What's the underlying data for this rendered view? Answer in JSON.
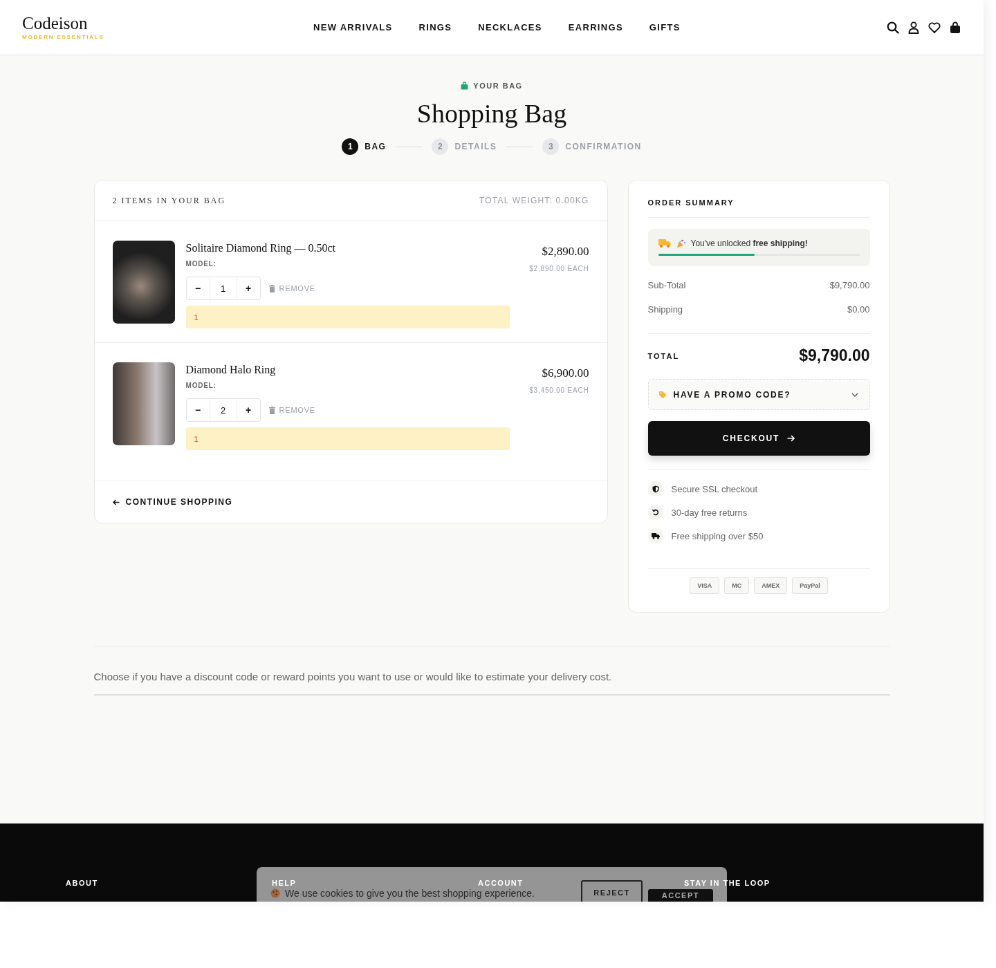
{
  "header": {
    "logo": "Codeison",
    "tagline": "MODERN ESSENTIALS",
    "nav": [
      "NEW ARRIVALS",
      "RINGS",
      "NECKLACES",
      "EARRINGS",
      "GIFTS"
    ]
  },
  "hero": {
    "eyebrow": "YOUR BAG",
    "title": "Shopping Bag",
    "steps": [
      {
        "number": "1",
        "label": "BAG",
        "selected": true
      },
      {
        "number": "2",
        "label": "DETAILS",
        "selected": false
      },
      {
        "number": "3",
        "label": "CONFIRMATION",
        "selected": false
      }
    ]
  },
  "bag": {
    "count": "2 ITEMS IN YOUR BAG",
    "weight": "TOTAL WEIGHT: 0.00KG",
    "items": [
      {
        "name": "Solitaire Diamond Ring — 0.50ct",
        "model": "MODEL:",
        "quantity": "1",
        "remove": "REMOVE",
        "note": "1",
        "price": "$2,890.00",
        "each": "$2,890.00 EACH",
        "minus": "−",
        "plus": "+"
      },
      {
        "name": "Diamond Halo Ring",
        "model": "MODEL:",
        "quantity": "2",
        "remove": "REMOVE",
        "note": "1",
        "price": "$6,900.00",
        "each": "$3,450.00 EACH",
        "minus": "−",
        "plus": "+"
      }
    ],
    "continue": "CONTINUE SHOPPING"
  },
  "summary": {
    "title": "ORDER SUMMARY",
    "shipping_notice": "You've unlocked **free shipping!**",
    "level": 0.48,
    "lines": [
      {
        "label": "Sub-Total",
        "value": "$9,790.00"
      },
      {
        "label": "Shipping",
        "value": "$0.00"
      }
    ],
    "total_label": "TOTAL",
    "total": "$9,790.00",
    "promo": "HAVE A PROMO CODE?",
    "checkout": "CHECKOUT",
    "assurances": [
      {
        "kind": "shield",
        "text": "Secure SSL checkout"
      },
      {
        "kind": "returns",
        "text": "30-day free returns"
      },
      {
        "kind": "truck",
        "text": "Free shipping over $50"
      }
    ],
    "payments": [
      "VISA",
      "MC",
      "AMEX",
      "PayPal"
    ]
  },
  "discount_note": "Choose if you have a discount code or reward points you want to use or would like to estimate your delivery cost.",
  "footer": {
    "headings": [
      "ABOUT",
      "HELP",
      "ACCOUNT",
      "STAY IN THE LOOP"
    ]
  },
  "cookie": {
    "text": "We use cookies to give you the best shopping experience.",
    "reject": "REJECT",
    "accept": "ACCEPT"
  }
}
